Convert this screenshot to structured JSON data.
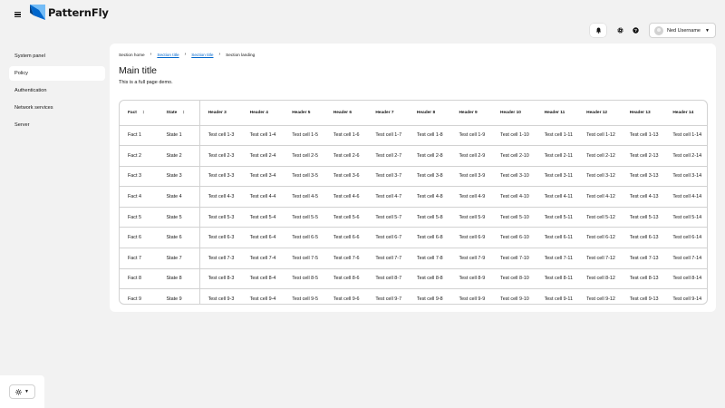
{
  "brand": {
    "name": "PatternFly"
  },
  "header": {
    "user_name": "Ned Username",
    "icons": [
      "bell-icon",
      "gear-icon",
      "help-icon"
    ]
  },
  "nav": {
    "items": [
      {
        "label": "System panel",
        "active": false
      },
      {
        "label": "Policy",
        "active": true
      },
      {
        "label": "Authentication",
        "active": false
      },
      {
        "label": "Network services",
        "active": false
      },
      {
        "label": "Server",
        "active": false
      }
    ]
  },
  "main": {
    "breadcrumb": [
      {
        "label": "Section home",
        "link": false
      },
      {
        "label": "Section title",
        "link": true
      },
      {
        "label": "Section title",
        "link": true
      },
      {
        "label": "Section landing",
        "link": false
      }
    ],
    "title": "Main title",
    "description": "This is a full page demo."
  },
  "table": {
    "headers": [
      "Fact",
      "State",
      "Header 3",
      "Header 4",
      "Header 5",
      "Header 6",
      "Header 7",
      "Header 8",
      "Header 9",
      "Header 10",
      "Header 11",
      "Header 12",
      "Header 13",
      "Header 14"
    ],
    "rows": [
      [
        "Fact 1",
        "State 1",
        "Test cell 1-3",
        "Test cell 1-4",
        "Test cell 1-5",
        "Test cell 1-6",
        "Test cell 1-7",
        "Test cell 1-8",
        "Test cell 1-9",
        "Test cell 1-10",
        "Test cell 1-11",
        "Test cell 1-12",
        "Test cell 1-13",
        "Test cell 1-14"
      ],
      [
        "Fact 2",
        "State 2",
        "Test cell 2-3",
        "Test cell 2-4",
        "Test cell 2-5",
        "Test cell 2-6",
        "Test cell 2-7",
        "Test cell 2-8",
        "Test cell 2-9",
        "Test cell 2-10",
        "Test cell 2-11",
        "Test cell 2-12",
        "Test cell 2-13",
        "Test cell 2-14"
      ],
      [
        "Fact 3",
        "State 3",
        "Test cell 3-3",
        "Test cell 3-4",
        "Test cell 3-5",
        "Test cell 3-6",
        "Test cell 3-7",
        "Test cell 3-8",
        "Test cell 3-9",
        "Test cell 3-10",
        "Test cell 3-11",
        "Test cell 3-12",
        "Test cell 3-13",
        "Test cell 3-14"
      ],
      [
        "Fact 4",
        "State 4",
        "Test cell 4-3",
        "Test cell 4-4",
        "Test cell 4-5",
        "Test cell 4-6",
        "Test cell 4-7",
        "Test cell 4-8",
        "Test cell 4-9",
        "Test cell 4-10",
        "Test cell 4-11",
        "Test cell 4-12",
        "Test cell 4-13",
        "Test cell 4-14"
      ],
      [
        "Fact 5",
        "State 5",
        "Test cell 5-3",
        "Test cell 5-4",
        "Test cell 5-5",
        "Test cell 5-6",
        "Test cell 5-7",
        "Test cell 5-8",
        "Test cell 5-9",
        "Test cell 5-10",
        "Test cell 5-11",
        "Test cell 5-12",
        "Test cell 5-13",
        "Test cell 5-14"
      ],
      [
        "Fact 6",
        "State 6",
        "Test cell 6-3",
        "Test cell 6-4",
        "Test cell 6-5",
        "Test cell 6-6",
        "Test cell 6-7",
        "Test cell 6-8",
        "Test cell 6-9",
        "Test cell 6-10",
        "Test cell 6-11",
        "Test cell 6-12",
        "Test cell 6-13",
        "Test cell 6-14"
      ],
      [
        "Fact 7",
        "State 7",
        "Test cell 7-3",
        "Test cell 7-4",
        "Test cell 7-5",
        "Test cell 7-6",
        "Test cell 7-7",
        "Test cell 7-8",
        "Test cell 7-9",
        "Test cell 7-10",
        "Test cell 7-11",
        "Test cell 7-12",
        "Test cell 7-13",
        "Test cell 7-14"
      ],
      [
        "Fact 8",
        "State 8",
        "Test cell 8-3",
        "Test cell 8-4",
        "Test cell 8-5",
        "Test cell 8-6",
        "Test cell 8-7",
        "Test cell 8-8",
        "Test cell 8-9",
        "Test cell 8-10",
        "Test cell 8-11",
        "Test cell 8-12",
        "Test cell 8-13",
        "Test cell 8-14"
      ],
      [
        "Fact 9",
        "State 9",
        "Test cell 9-3",
        "Test cell 9-4",
        "Test cell 9-5",
        "Test cell 9-6",
        "Test cell 9-7",
        "Test cell 9-8",
        "Test cell 9-9",
        "Test cell 9-10",
        "Test cell 9-11",
        "Test cell 9-12",
        "Test cell 9-13",
        "Test cell 9-14"
      ]
    ]
  },
  "theme_selector": {
    "icon": "sun-icon"
  },
  "colors": {
    "background": "#f2f2f2",
    "surface": "#ffffff",
    "link": "#0066cc",
    "border": "#d2d2d2",
    "brand_blue_dark": "#0066cc",
    "brand_blue_light": "#73bcf7"
  }
}
